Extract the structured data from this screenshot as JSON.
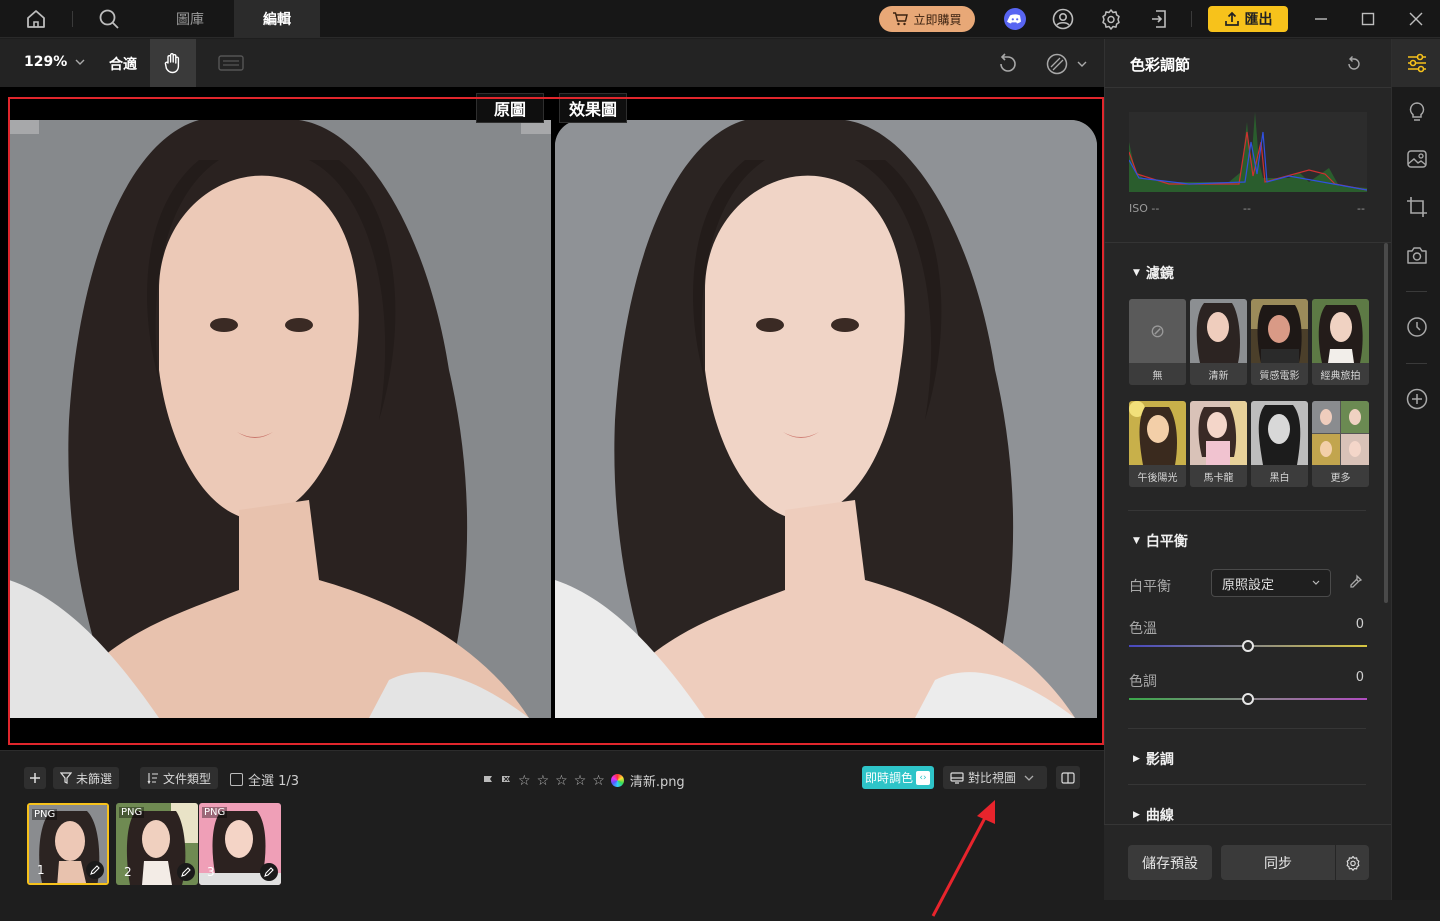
{
  "topbar": {
    "tabs": [
      {
        "label": "圖庫"
      },
      {
        "label": "編輯"
      }
    ],
    "buy_label": "立即購買",
    "export_label": "匯出"
  },
  "toolbar": {
    "zoom": "129%",
    "fit_label": "合適"
  },
  "canvas": {
    "original_label": "原圖",
    "result_label": "效果圖"
  },
  "bottom": {
    "filter_label": "未篩選",
    "filetype_label": "文件類型",
    "select_all_label": "全選 1/3",
    "filename": "清新.png",
    "live_color_label": "即時調色",
    "compare_view_label": "對比視圖",
    "thumbnails": [
      {
        "badge": "PNG",
        "number": "1"
      },
      {
        "badge": "PNG",
        "number": "2"
      },
      {
        "badge": "PNG",
        "number": "3"
      }
    ]
  },
  "panel": {
    "title": "色彩調節",
    "histogram": {
      "iso": "ISO --",
      "v1": "--",
      "v2": "--"
    },
    "filters": {
      "title": "濾鏡",
      "items": [
        "無",
        "清新",
        "質感電影",
        "經典旅拍",
        "午後陽光",
        "馬卡龍",
        "黑白",
        "更多"
      ]
    },
    "white_balance": {
      "title": "白平衡",
      "label": "白平衡",
      "select_value": "原照設定",
      "temp_label": "色溫",
      "temp_value": "0",
      "tint_label": "色調",
      "tint_value": "0"
    },
    "tone_title": "影調",
    "curve_title": "曲線",
    "save_preset_label": "儲存預設",
    "sync_label": "同步"
  },
  "colors": {
    "accent": "#f7c21b",
    "frame": "#e0262c",
    "live": "#2ec4c8"
  }
}
